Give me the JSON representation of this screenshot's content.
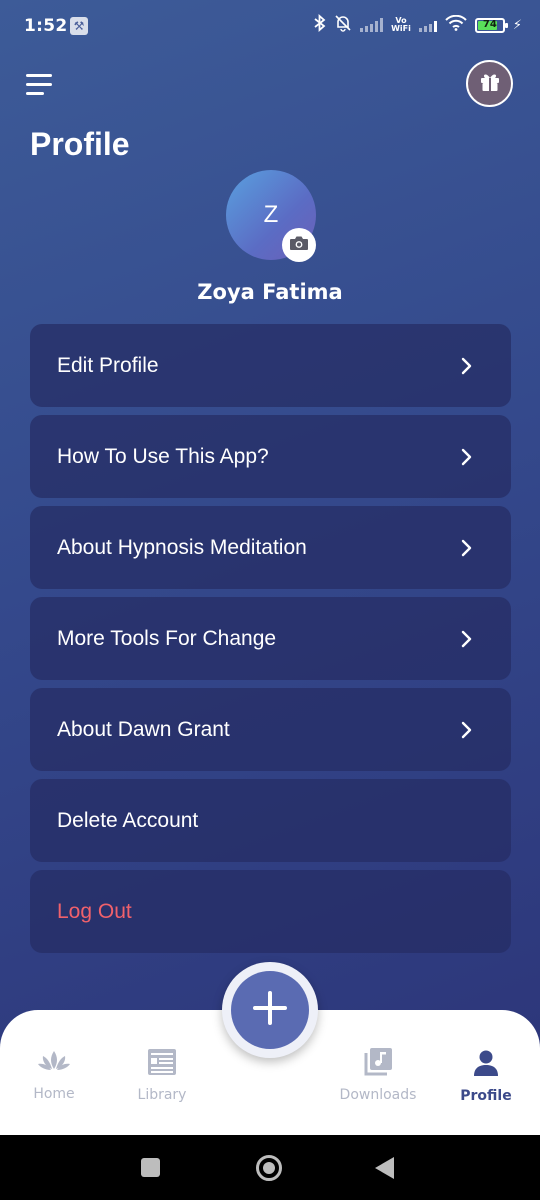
{
  "status_bar": {
    "time": "1:52",
    "battery_level": "74",
    "vowifi_top": "Vo",
    "vowifi_bottom": "WiFi",
    "icons": [
      "wrench-icon",
      "bluetooth-icon",
      "bell-muted-icon",
      "signal-icon",
      "vowifi-icon",
      "signal-icon",
      "wifi-icon",
      "battery-icon",
      "charging-icon"
    ]
  },
  "header": {
    "menu_icon": "hamburger-icon",
    "gift_icon": "gift-icon",
    "title": "Profile"
  },
  "profile": {
    "avatar_initial": "Z",
    "name": "Zoya Fatima",
    "camera_icon": "camera-icon"
  },
  "menu": [
    {
      "label": "Edit Profile",
      "has_chevron": true
    },
    {
      "label": "How To Use This App?",
      "has_chevron": true
    },
    {
      "label": "About Hypnosis Meditation",
      "has_chevron": true
    },
    {
      "label": "More Tools For Change",
      "has_chevron": true
    },
    {
      "label": "About Dawn Grant",
      "has_chevron": true
    },
    {
      "label": "Delete Account",
      "has_chevron": false
    },
    {
      "label": "Log Out",
      "has_chevron": false
    }
  ],
  "bottom_nav": {
    "items": [
      {
        "label": "Home",
        "icon": "lotus-icon",
        "active": false
      },
      {
        "label": "Library",
        "icon": "library-icon",
        "active": false
      },
      {
        "label": "Downloads",
        "icon": "music-library-icon",
        "active": false
      },
      {
        "label": "Profile",
        "icon": "person-icon",
        "active": true
      }
    ],
    "fab_icon": "plus-icon"
  },
  "colors": {
    "background_top": "#3d5b98",
    "background_bottom": "#2c3478",
    "card": "#262c64",
    "logout": "#f0616b",
    "nav_active": "#3c4a8a",
    "nav_inactive": "#b3b8c7",
    "fab": "#5a6bb2"
  }
}
